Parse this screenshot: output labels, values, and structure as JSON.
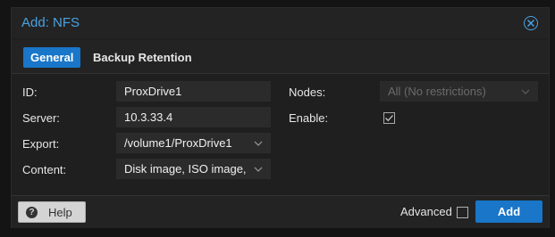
{
  "dialog": {
    "title": "Add: NFS",
    "close_icon": "close-circle-icon",
    "accent_color": "#4aa2e3",
    "primary_color": "#1976c8"
  },
  "tabs": [
    {
      "label": "General",
      "active": true
    },
    {
      "label": "Backup Retention",
      "active": false
    }
  ],
  "form": {
    "id_label": "ID:",
    "id_value": "ProxDrive1",
    "server_label": "Server:",
    "server_value": "10.3.33.4",
    "export_label": "Export:",
    "export_value": "/volume1/ProxDrive1",
    "content_label": "Content:",
    "content_value": "Disk image, ISO image,",
    "nodes_label": "Nodes:",
    "nodes_value": "All (No restrictions)",
    "enable_label": "Enable:",
    "enable_checked": true
  },
  "footer": {
    "help_label": "Help",
    "help_icon": "question-circle-icon",
    "advanced_label": "Advanced",
    "advanced_checked": false,
    "add_label": "Add"
  }
}
